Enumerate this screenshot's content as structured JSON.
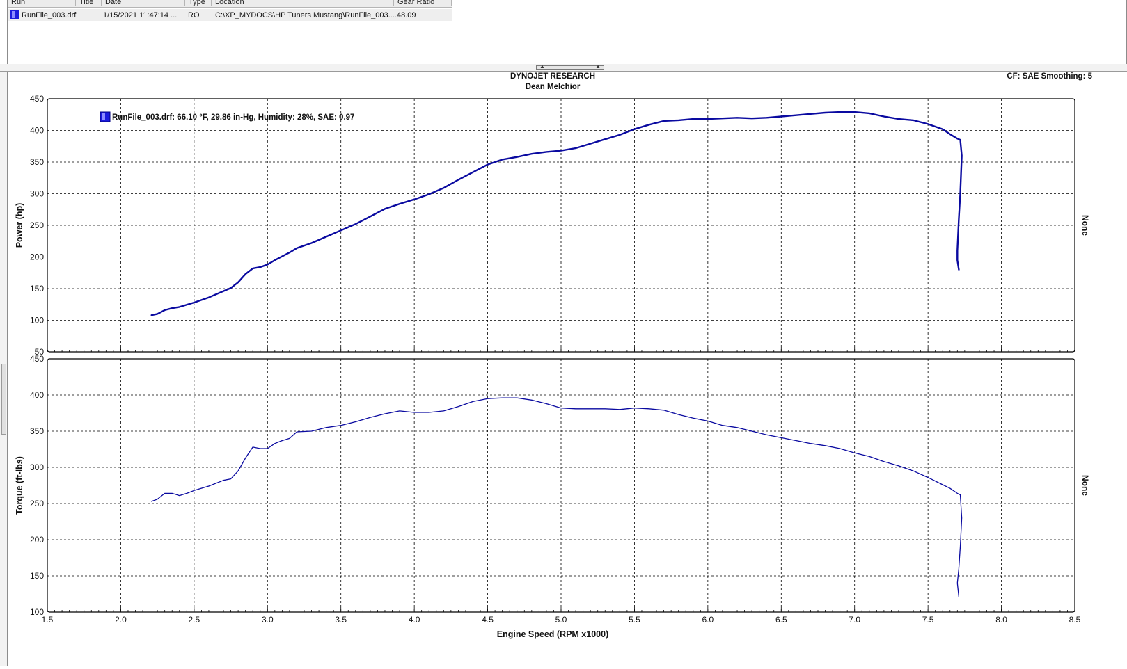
{
  "run_table": {
    "headers": [
      "Run",
      "Title",
      "Date",
      "Type",
      "Location",
      "Gear Ratio"
    ],
    "rows": [
      {
        "run": "RunFile_003.drf",
        "title": "",
        "date": "1/15/2021 11:47:14 ...",
        "type": "RO",
        "location": "C:\\XP_MYDOCS\\HP Tuners Mustang\\RunFile_003....",
        "gear_ratio": "48.09",
        "color": "#1b1bdc"
      }
    ]
  },
  "header": {
    "company": "DYNOJET RESEARCH",
    "customer": "Dean Melchior",
    "cf_smoothing": "CF: SAE  Smoothing: 5"
  },
  "colors": {
    "series": "#0a0aa0",
    "grid": "#000000",
    "frame": "#000000"
  },
  "chart_data": [
    {
      "type": "line",
      "ylabel": "Power (hp)",
      "right_label": "None",
      "legend": "RunFile_003.drf: 66.10 °F, 29.86 in-Hg, Humidity: 28%, SAE: 0.97",
      "xlim": [
        1.5,
        8.5
      ],
      "ylim": [
        50,
        450
      ],
      "yticks": [
        "50",
        "100",
        "150",
        "200",
        "250",
        "300",
        "350",
        "400",
        "450"
      ],
      "grid": true,
      "series": [
        {
          "x": [
            2.21,
            2.25,
            2.3,
            2.35,
            2.4,
            2.5,
            2.6,
            2.7,
            2.75,
            2.8,
            2.85,
            2.9,
            2.95,
            3.0,
            3.05,
            3.1,
            3.15,
            3.2,
            3.3,
            3.4,
            3.5,
            3.6,
            3.7,
            3.8,
            3.9,
            4.0,
            4.1,
            4.2,
            4.3,
            4.4,
            4.5,
            4.6,
            4.7,
            4.8,
            4.9,
            5.0,
            5.1,
            5.2,
            5.3,
            5.4,
            5.5,
            5.6,
            5.7,
            5.8,
            5.9,
            6.0,
            6.1,
            6.2,
            6.3,
            6.4,
            6.5,
            6.6,
            6.7,
            6.8,
            6.9,
            7.0,
            7.1,
            7.2,
            7.3,
            7.4,
            7.5,
            7.6,
            7.65,
            7.7,
            7.72,
            7.73,
            7.72,
            7.71,
            7.7,
            7.7,
            7.71
          ],
          "y": [
            108,
            110,
            116,
            119,
            121,
            128,
            136,
            146,
            151,
            160,
            173,
            182,
            184,
            188,
            195,
            201,
            207,
            214,
            222,
            232,
            242,
            252,
            264,
            276,
            284,
            291,
            299,
            309,
            322,
            334,
            346,
            354,
            358,
            363,
            366,
            368,
            372,
            379,
            386,
            393,
            402,
            409,
            415,
            416,
            418,
            418,
            419,
            420,
            419,
            420,
            422,
            424,
            426,
            428,
            429,
            429,
            427,
            422,
            418,
            416,
            410,
            402,
            394,
            387,
            385,
            360,
            300,
            260,
            210,
            195,
            180
          ]
        }
      ]
    },
    {
      "type": "line",
      "ylabel": "Torque (ft-lbs)",
      "right_label": "None",
      "xlabel": "Engine Speed (RPM x1000)",
      "xlim": [
        1.5,
        8.5
      ],
      "ylim": [
        100,
        450
      ],
      "xticks": [
        "1.5",
        "2.0",
        "2.5",
        "3.0",
        "3.5",
        "4.0",
        "4.5",
        "5.0",
        "5.5",
        "6.0",
        "6.5",
        "7.0",
        "7.5",
        "8.0",
        "8.5"
      ],
      "yticks": [
        "100",
        "150",
        "200",
        "250",
        "300",
        "350",
        "400",
        "450"
      ],
      "grid": true,
      "series": [
        {
          "x": [
            2.21,
            2.25,
            2.3,
            2.35,
            2.4,
            2.45,
            2.5,
            2.6,
            2.7,
            2.75,
            2.8,
            2.85,
            2.9,
            2.95,
            3.0,
            3.05,
            3.1,
            3.15,
            3.2,
            3.3,
            3.4,
            3.5,
            3.6,
            3.7,
            3.8,
            3.9,
            4.0,
            4.1,
            4.2,
            4.3,
            4.4,
            4.5,
            4.6,
            4.7,
            4.8,
            4.9,
            5.0,
            5.1,
            5.2,
            5.3,
            5.4,
            5.5,
            5.6,
            5.7,
            5.8,
            5.9,
            6.0,
            6.1,
            6.2,
            6.3,
            6.4,
            6.5,
            6.6,
            6.7,
            6.8,
            6.9,
            7.0,
            7.1,
            7.2,
            7.3,
            7.4,
            7.5,
            7.6,
            7.65,
            7.7,
            7.72,
            7.73,
            7.72,
            7.71,
            7.7,
            7.71
          ],
          "y": [
            253,
            256,
            264,
            264,
            261,
            264,
            268,
            274,
            282,
            284,
            295,
            313,
            328,
            326,
            326,
            333,
            337,
            340,
            349,
            350,
            355,
            358,
            363,
            369,
            374,
            378,
            376,
            376,
            378,
            384,
            391,
            395,
            396,
            396,
            393,
            388,
            382,
            381,
            381,
            381,
            380,
            382,
            381,
            379,
            373,
            368,
            364,
            358,
            355,
            350,
            345,
            341,
            337,
            333,
            330,
            326,
            320,
            315,
            308,
            302,
            295,
            286,
            276,
            271,
            264,
            262,
            230,
            190,
            160,
            140,
            121
          ]
        }
      ]
    }
  ]
}
